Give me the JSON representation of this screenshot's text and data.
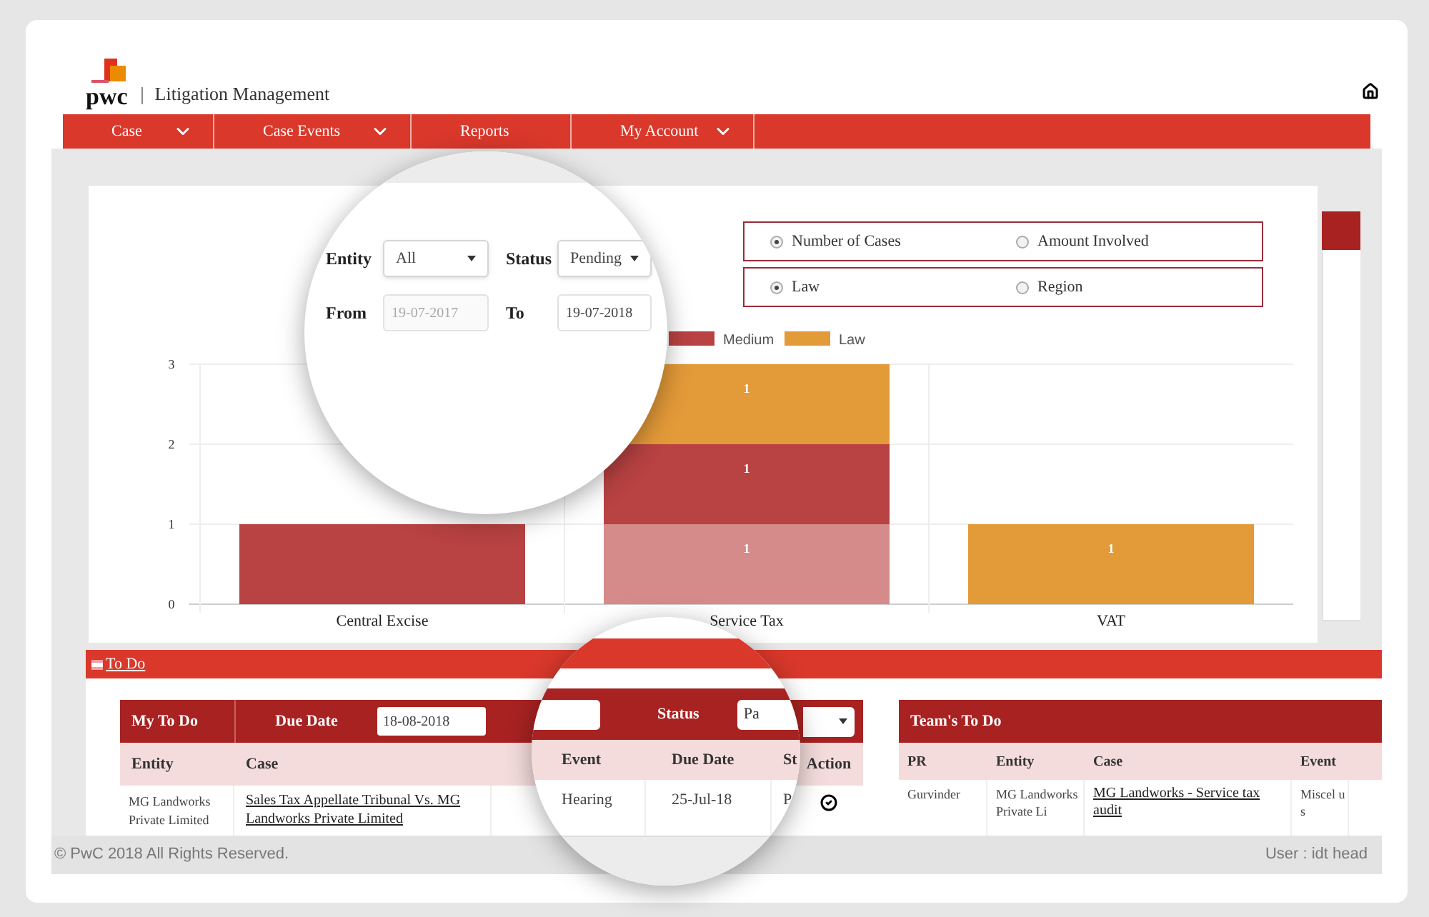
{
  "header": {
    "logo": "pwc",
    "title": "Litigation Management"
  },
  "nav": [
    {
      "label": "Case",
      "dropdown": true
    },
    {
      "label": "Case Events",
      "dropdown": true
    },
    {
      "label": "Reports",
      "dropdown": false
    },
    {
      "label": "My Account",
      "dropdown": true
    }
  ],
  "magnifier_1": {
    "filters": [
      {
        "label": "Entity",
        "value": "All",
        "kind": "select"
      },
      {
        "label": "Status",
        "value": "Pending",
        "kind": "select"
      },
      {
        "label": "From",
        "value": "19-07-2017",
        "kind": "date",
        "disabled": true
      },
      {
        "label": "To",
        "value": "19-07-2018",
        "kind": "date",
        "disabled": false
      }
    ]
  },
  "radio_groups": [
    {
      "options": [
        {
          "label": "Number of Cases",
          "selected": true
        },
        {
          "label": "Amount Involved",
          "selected": false
        }
      ]
    },
    {
      "options": [
        {
          "label": "Law",
          "selected": true
        },
        {
          "label": "Region",
          "selected": false
        }
      ]
    }
  ],
  "chart_data": {
    "type": "bar",
    "stacked": true,
    "categories": [
      "Central Excise",
      "Service Tax",
      "VAT"
    ],
    "ylim": [
      0,
      3
    ],
    "yticks": [
      0,
      1,
      2,
      3
    ],
    "legend": "top",
    "series": [
      {
        "color": "#d68b8b",
        "values": [
          null,
          1,
          null
        ],
        "value_labels": [
          null,
          "1",
          null
        ]
      },
      {
        "name": "Medium",
        "color": "#b94242",
        "values": [
          1,
          1,
          null
        ],
        "value_labels": [
          null,
          "1",
          null
        ]
      },
      {
        "name": "Law",
        "color": "#e39a38",
        "values": [
          null,
          1,
          1
        ],
        "value_labels": [
          null,
          "1",
          "1"
        ]
      }
    ]
  },
  "to_do": {
    "title": "To Do",
    "my_to_do": {
      "title": "My To Do",
      "due_date_label": "Due Date",
      "due_date": "18-08-2018",
      "columns": [
        "Entity",
        "Case",
        "Action"
      ],
      "rows": [
        {
          "entity": "MG Landworks Private Limited",
          "case": "Sales Tax Appellate Tribunal Vs. MG Landworks Private Limited",
          "done": true
        }
      ]
    },
    "teams_to_do": {
      "title": "Team's To Do",
      "columns": [
        "PR",
        "Entity",
        "Case",
        "Event"
      ],
      "rows": [
        {
          "pr": "Gurvinder",
          "entity": "MG Landworks Private Li",
          "case": "MG Landworks - Service tax audit",
          "event": "Miscel us"
        }
      ]
    }
  },
  "magnifier_2": {
    "status_label": "Status",
    "status_value": "Pa",
    "columns": [
      "Event",
      "Due Date",
      "St"
    ],
    "row": [
      "Hearing",
      "25-Jul-18",
      "P"
    ]
  },
  "footer": {
    "copyright": "© PwC 2018 All Rights Reserved.",
    "user": "User : idt head"
  }
}
